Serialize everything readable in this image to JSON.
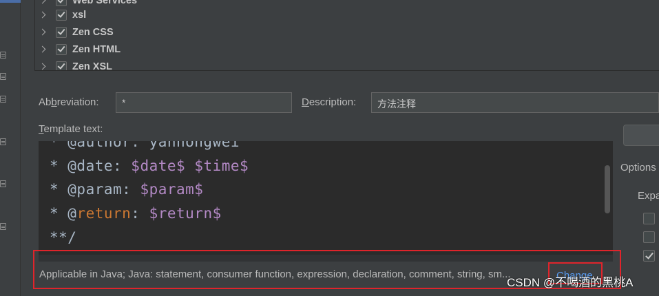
{
  "tree": {
    "items": [
      {
        "label": "Web Services",
        "checked": true
      },
      {
        "label": "xsl",
        "checked": true
      },
      {
        "label": "Zen CSS",
        "checked": true
      },
      {
        "label": "Zen HTML",
        "checked": true
      },
      {
        "label": "Zen XSL",
        "checked": true
      }
    ]
  },
  "form": {
    "abbreviation_label_pre": "Ab",
    "abbreviation_label_mn": "b",
    "abbreviation_label_post": "reviation:",
    "abbreviation_value": "*",
    "description_label_mn": "D",
    "description_label_post": "escription:",
    "description_value": "方法注释",
    "template_label_mn": "T",
    "template_label_post": "emplate text:"
  },
  "editor": {
    "lines": [
      {
        "prefix": "* @author: ",
        "var": "yanhongwei",
        "suffix": ""
      },
      {
        "prefix": "* @date: ",
        "var": "$date$",
        "mid": " ",
        "var2": "$time$"
      },
      {
        "prefix": "* @param: ",
        "var": "$param$"
      },
      {
        "prefix": "* @",
        "kw": "return",
        "colon": ": ",
        "var": "$return$"
      },
      {
        "prefix": "**/"
      }
    ]
  },
  "footer": {
    "applicable_text": "Applicable in Java; Java: statement, consumer function, expression, declaration, comment, string, sm...",
    "change_label": "Change"
  },
  "right_panel": {
    "options_label": "Options",
    "expand_label": "Expa"
  },
  "watermark": "CSDN @不喝酒的黑桃A",
  "colors": {
    "background": "#3c3f41",
    "editor_bg": "#2b2b2b",
    "template_var": "#b389c5",
    "keyword": "#cc7832",
    "link": "#589df6",
    "highlight_box": "#e0242b"
  }
}
